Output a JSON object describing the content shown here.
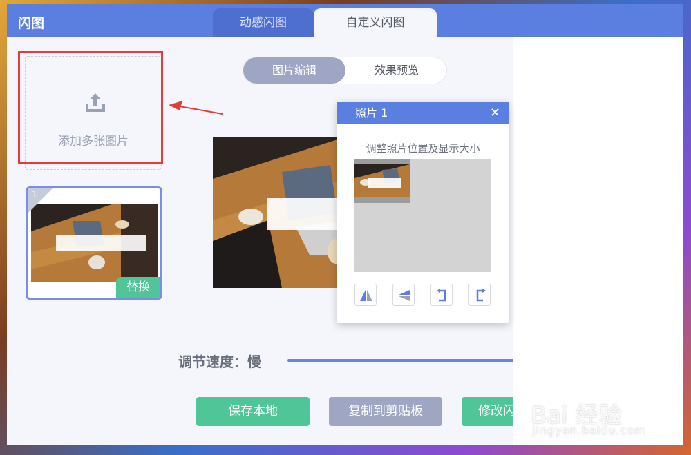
{
  "app": {
    "title": "闪图"
  },
  "tabs": [
    {
      "label": "动感闪图"
    },
    {
      "label": "自定义闪图"
    }
  ],
  "left": {
    "add_label": "添加多张图片",
    "thumb_index": "1",
    "replace_label": "替换"
  },
  "center": {
    "segment": [
      {
        "label": "图片编辑"
      },
      {
        "label": "效果预览"
      }
    ],
    "speed_label": "调节速度：慢",
    "buttons": {
      "save": "保存本地",
      "copy": "复制到剪贴板",
      "modify": "修改闪"
    }
  },
  "popup": {
    "title": "照片 1",
    "close": "✕",
    "hint": "调整照片位置及显示大小",
    "tools": [
      "flip-horizontal-icon",
      "flip-vertical-icon",
      "rotate-left-icon",
      "rotate-right-icon"
    ]
  },
  "watermark": {
    "brand": "Bai 经验",
    "url": "jingyan.baidu.com"
  },
  "colors": {
    "accent": "#5b7fe0",
    "green": "#4fc598",
    "gray_button": "#9ea6c4",
    "annotation_red": "#e63b3b"
  }
}
